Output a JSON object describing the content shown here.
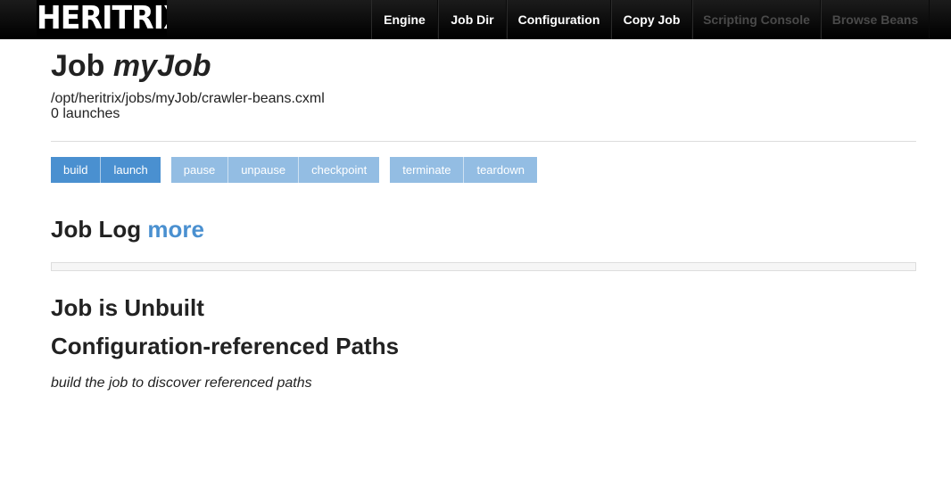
{
  "header": {
    "logo_text": "HERITRIX",
    "nav": [
      {
        "label": "Engine",
        "enabled": true
      },
      {
        "label": "Job Dir",
        "enabled": true
      },
      {
        "label": "Configuration",
        "enabled": true
      },
      {
        "label": "Copy Job",
        "enabled": true
      },
      {
        "label": "Scripting Console",
        "enabled": false
      },
      {
        "label": "Browse Beans",
        "enabled": false
      }
    ]
  },
  "job": {
    "title_prefix": "Job",
    "name": "myJob",
    "config_path": "/opt/heritrix/jobs/myJob/crawler-beans.cxml",
    "launches": "0 launches"
  },
  "actions": {
    "groups": [
      [
        {
          "label": "build",
          "enabled": true
        },
        {
          "label": "launch",
          "enabled": true
        }
      ],
      [
        {
          "label": "pause",
          "enabled": false
        },
        {
          "label": "unpause",
          "enabled": false
        },
        {
          "label": "checkpoint",
          "enabled": false
        }
      ],
      [
        {
          "label": "terminate",
          "enabled": false
        },
        {
          "label": "teardown",
          "enabled": false
        }
      ]
    ]
  },
  "job_log": {
    "heading": "Job Log",
    "more_link": "more"
  },
  "status": {
    "heading": "Job is Unbuilt"
  },
  "paths": {
    "heading": "Configuration-referenced Paths",
    "note": "build the job to discover referenced paths"
  },
  "colors": {
    "accent": "#4a90d0",
    "accent_disabled": "#93bde3",
    "nav_bg": "#000000"
  }
}
